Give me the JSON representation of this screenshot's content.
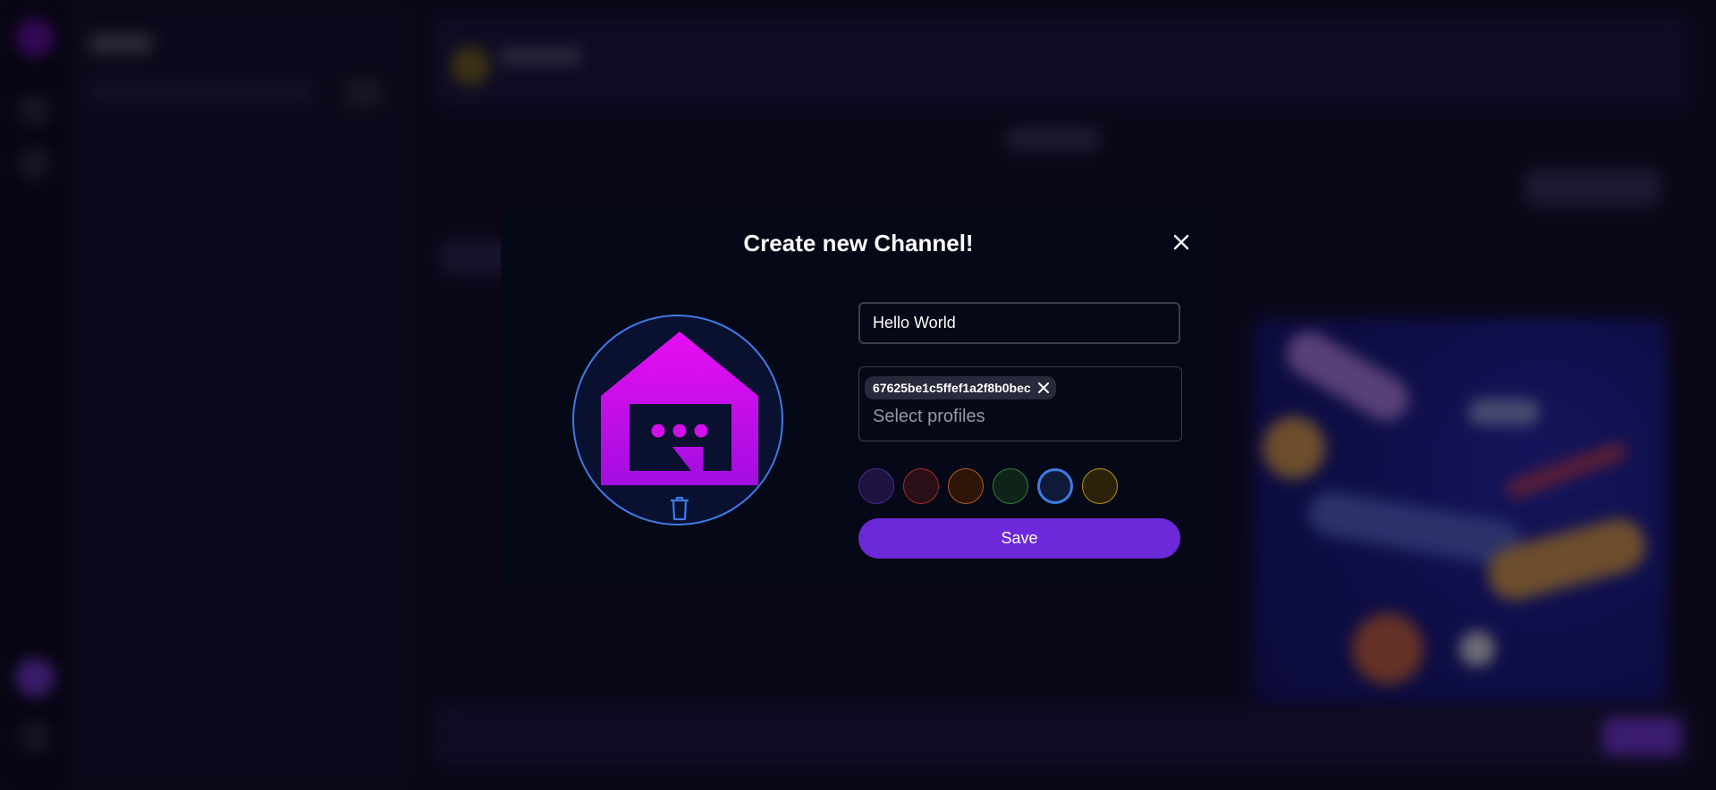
{
  "modal": {
    "title": "Create new Channel!",
    "channel_name_value": "Hello World",
    "selected_profiles": [
      "67625be1c5ffef1a2f8b0bec"
    ],
    "profiles_placeholder": "Select profiles",
    "save_label": "Save",
    "avatar_icon": "house-chat-icon",
    "colors": {
      "accent": "#6d28d9",
      "avatar_border": "#3d7be6",
      "house_gradient_top": "#e80ff2",
      "house_gradient_bottom": "#a20de0",
      "background": "#050816"
    },
    "swatches": [
      {
        "name": "purple",
        "fill": "#1d1240",
        "border": "#4c2a94",
        "selected": false
      },
      {
        "name": "red",
        "fill": "#2a0f16",
        "border": "#a42a2a",
        "selected": false
      },
      {
        "name": "orange",
        "fill": "#2e1508",
        "border": "#b05a1e",
        "selected": false
      },
      {
        "name": "green",
        "fill": "#0f2418",
        "border": "#2e7d3e",
        "selected": false
      },
      {
        "name": "blue",
        "fill": "#0f1a3a",
        "border": "#3d7be6",
        "selected": true
      },
      {
        "name": "yellow",
        "fill": "#2c2208",
        "border": "#b8920e",
        "selected": false
      }
    ]
  }
}
